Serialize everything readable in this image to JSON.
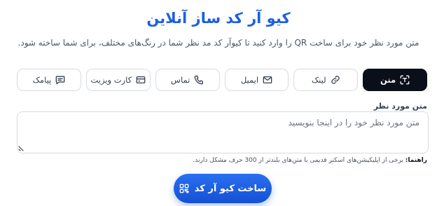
{
  "header": {
    "title": "کیو آر کد ساز آنلاین",
    "subtitle": "متن مورد نظر خود برای ساخت QR را وارد کنید تا کیوآر کد مد نظر شما در رنگ‌های مختلف، برای شما ساخته شود."
  },
  "tabs": [
    {
      "label": "متن",
      "icon": "text-scan-icon",
      "active": true
    },
    {
      "label": "لینک",
      "icon": "link-icon",
      "active": false
    },
    {
      "label": "ایمیل",
      "icon": "mail-icon",
      "active": false
    },
    {
      "label": "تماس",
      "icon": "phone-icon",
      "active": false
    },
    {
      "label": "کارت ویزیت",
      "icon": "card-icon",
      "active": false
    },
    {
      "label": "پیامک",
      "icon": "message-icon",
      "active": false
    }
  ],
  "form": {
    "label": "متن مورد نظر",
    "placeholder": "متن مورد نظر خود را در اینجا بنویسید",
    "value": "",
    "hint_title": "راهنما:",
    "hint_text": "برخی از اپلیکیشن‌های اسکنر قدیمی با متن‌های بلندتر از 300 حرف مشکل دارند.",
    "submit_label": "ساخت کیو آر کد",
    "submit_icon": "qr-code-icon"
  },
  "colors": {
    "accent": "#1d5fe0",
    "active_tab": "#0b0f1a"
  }
}
